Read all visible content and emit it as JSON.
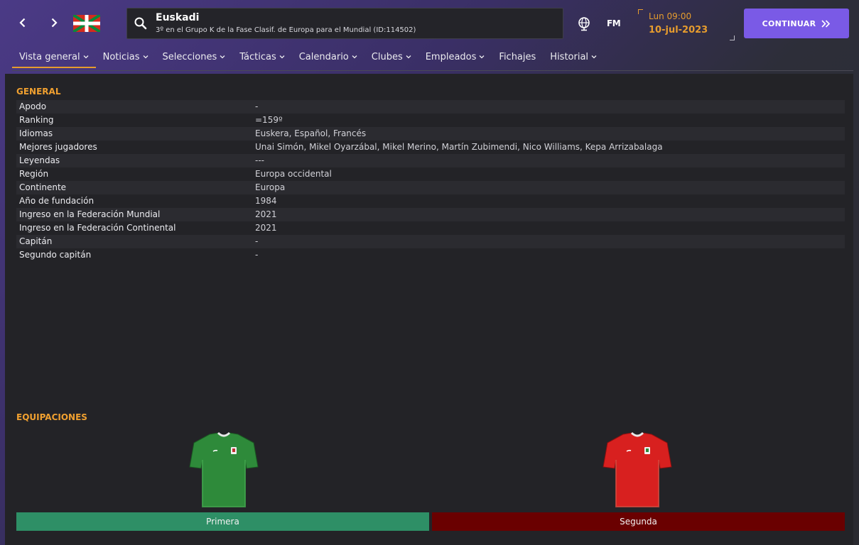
{
  "header": {
    "team_name": "Euskadi",
    "team_subtitle": "3º en el Grupo K de la Fase Clasif. de Europa para el Mundial (ID:114502)",
    "brand": "FM",
    "time": "Lun 09:00",
    "date": "10-jul-2023",
    "continue_label": "CONTINUAR",
    "icons": {
      "back": "chevron-left-icon",
      "forward": "chevron-right-icon",
      "flag": "basque-flag-icon",
      "search": "search-icon",
      "globe": "globe-icon",
      "continue": "double-chevron-right-icon"
    }
  },
  "tabs": [
    {
      "label": "Vista general",
      "dropdown": true,
      "active": true
    },
    {
      "label": "Noticias",
      "dropdown": true
    },
    {
      "label": "Selecciones",
      "dropdown": true
    },
    {
      "label": "Tácticas",
      "dropdown": true
    },
    {
      "label": "Calendario",
      "dropdown": true
    },
    {
      "label": "Clubes",
      "dropdown": true
    },
    {
      "label": "Empleados",
      "dropdown": true
    },
    {
      "label": "Fichajes",
      "dropdown": false
    },
    {
      "label": "Historial",
      "dropdown": true
    }
  ],
  "general": {
    "title": "GENERAL",
    "rows": [
      {
        "label": "Apodo",
        "value": "-"
      },
      {
        "label": "Ranking",
        "value": "=159º"
      },
      {
        "label": "Idiomas",
        "value": "Euskera, Español, Francés"
      },
      {
        "label": "Mejores jugadores",
        "value": "Unai Simón, Mikel Oyarzábal, Mikel Merino, Martín Zubimendi, Nico Williams, Kepa Arrizabalaga"
      },
      {
        "label": "Leyendas",
        "value": "---"
      },
      {
        "label": "Región",
        "value": "Europa occidental"
      },
      {
        "label": "Continente",
        "value": "Europa"
      },
      {
        "label": "Año de fundación",
        "value": "1984"
      },
      {
        "label": "Ingreso en la Federación Mundial",
        "value": "2021"
      },
      {
        "label": "Ingreso en la Federación Continental",
        "value": "2021"
      },
      {
        "label": "Capitán",
        "value": "-"
      },
      {
        "label": "Segundo capitán",
        "value": "-"
      }
    ]
  },
  "kits": {
    "title": "EQUIPACIONES",
    "items": [
      {
        "label": "Primera",
        "shirt_color": "#2e8a3a",
        "bar_color": "#2e8f66"
      },
      {
        "label": "Segunda",
        "shirt_color": "#d8201f",
        "bar_color": "#6a0000"
      }
    ]
  },
  "colors": {
    "accent": "#e69c2e",
    "continue_button": "#7a5ae6",
    "panel": "#232327"
  }
}
